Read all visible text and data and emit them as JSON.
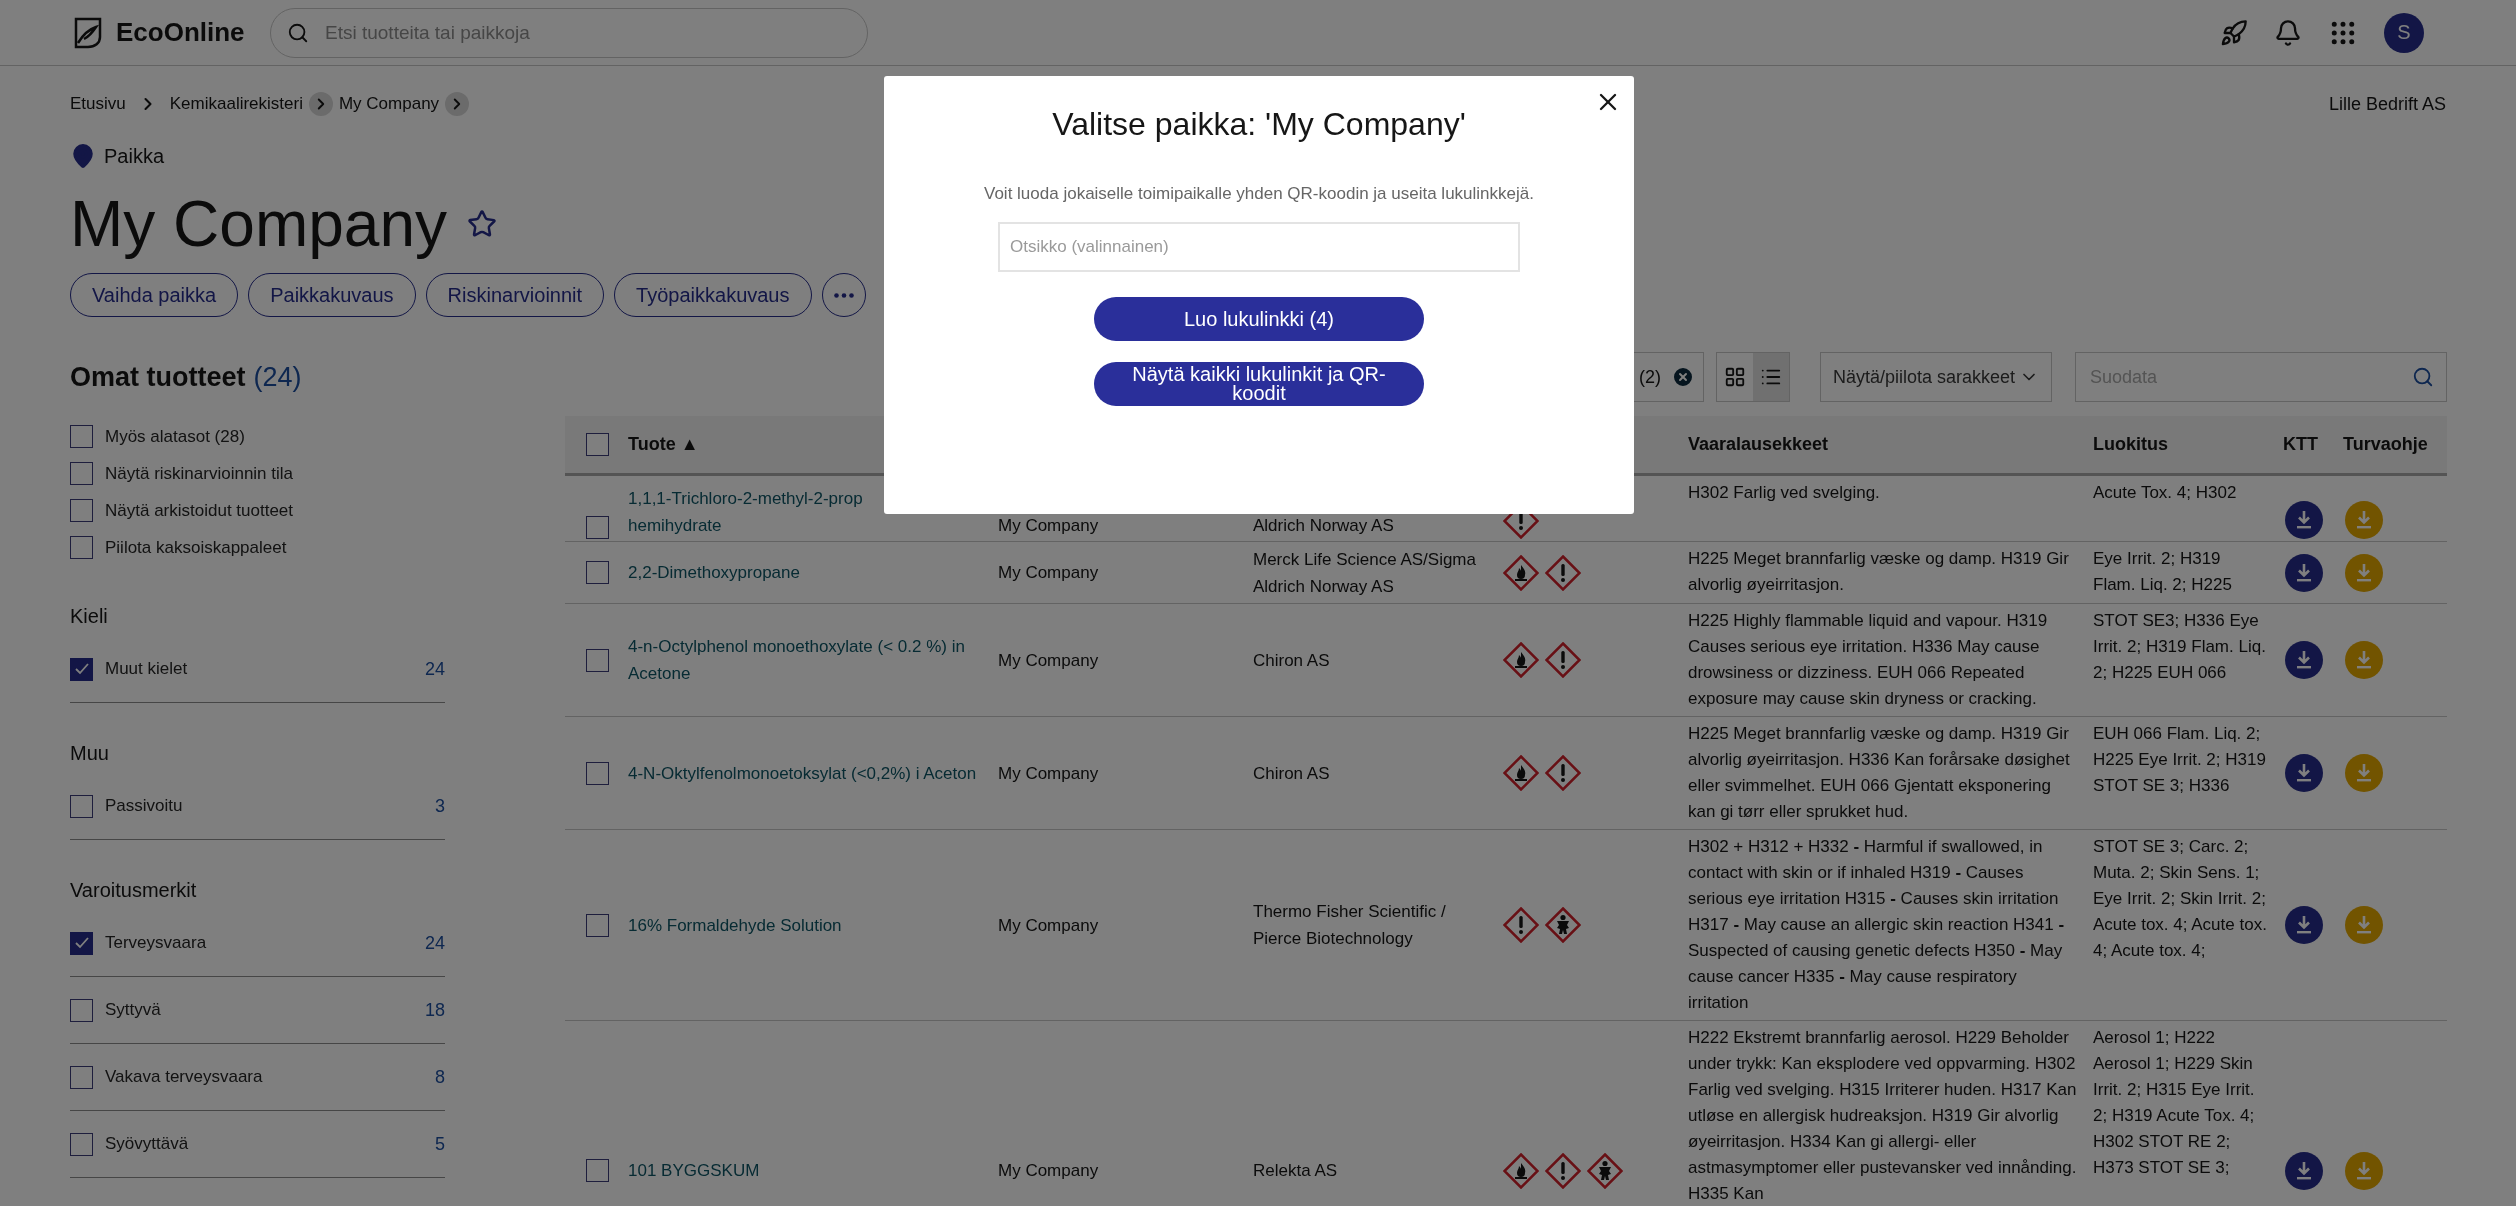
{
  "header": {
    "logo": "EcoOnline",
    "search_placeholder": "Etsi tuotteita tai paikkoja",
    "avatar": "S"
  },
  "breadcrumb": [
    {
      "label": "Etusivu",
      "kind": "plain"
    },
    {
      "label": "Kemikaalirekisteri",
      "kind": "circled"
    },
    {
      "label": "My Company",
      "kind": "circled"
    }
  ],
  "company": "Lille Bedrift AS",
  "location_type": "Paikka",
  "title": "My Company",
  "favorite": false,
  "actions": [
    "Vaihda paikka",
    "Paikkakuvaus",
    "Riskinarvioinnit",
    "Työpaikkakuvaus"
  ],
  "products_heading": {
    "label": "Omat tuotteet",
    "count": "(24)"
  },
  "filter_groups": [
    {
      "items": [
        {
          "label": "Myös alatasot (28)",
          "checked": false
        },
        {
          "label": "Näytä riskinarvioinnin tila",
          "checked": false
        },
        {
          "label": "Näytä arkistoidut tuotteet",
          "checked": false
        },
        {
          "label": "Piilota kaksoiskappaleet",
          "checked": false
        }
      ]
    },
    {
      "title": "Kieli",
      "items": [
        {
          "label": "Muut kielet",
          "checked": true,
          "count": "24"
        }
      ]
    },
    {
      "title": "Muu",
      "items": [
        {
          "label": "Passivoitu",
          "checked": false,
          "count": "3"
        }
      ]
    },
    {
      "title": "Varoitusmerkit",
      "items": [
        {
          "label": "Terveysvaara",
          "checked": true,
          "count": "24"
        },
        {
          "label": "Syttyvä",
          "checked": false,
          "count": "18"
        },
        {
          "label": "Vakava terveysvaara",
          "checked": false,
          "count": "8"
        },
        {
          "label": "Syövyttävä",
          "checked": false,
          "count": "5"
        }
      ]
    }
  ],
  "toolbar": {
    "chip": "(2)",
    "views": [
      {
        "kind": "grid",
        "selected": false
      },
      {
        "kind": "list",
        "selected": true
      }
    ],
    "columns_dropdown": "Näytä/piilota sarakkeet",
    "filter_placeholder": "Suodata"
  },
  "table": {
    "select_all": {
      "checked": false
    },
    "columns": {
      "product": "Tuote ▲",
      "hazard_statements": "Vaaralausekkeet",
      "classification": "Luokitus",
      "sds": "KTT",
      "safety_instructions": "Turvaohje"
    },
    "rows": [
      {
        "checked": false,
        "product": "1,1,1-Trichloro-2-methyl-2-prop\nhemihydrate",
        "location": "My Company",
        "supplier": "Aldrich Norway AS",
        "pictograms": [
          {
            "kind": "exclamation"
          }
        ],
        "hazard_statements": "H302 Farlig ved svelging.",
        "classification": "Acute Tox. 4; H302"
      },
      {
        "checked": false,
        "product": "2,2-Dimethoxypropane",
        "location": "My Company",
        "supplier": "Merck Life Science AS/Sigma Aldrich Norway AS",
        "pictograms": [
          {
            "kind": "flame"
          },
          {
            "kind": "exclamation"
          }
        ],
        "hazard_statements": "H225 Meget brannfarlig væske og damp. H319 Gir alvorlig øyeirritasjon.",
        "classification": "Eye Irrit. 2; H319 Flam. Liq. 2; H225"
      },
      {
        "checked": false,
        "product": "4-n-Octylphenol monoethoxylate (< 0.2 %) in Acetone",
        "location": "My Company",
        "supplier": "Chiron AS",
        "pictograms": [
          {
            "kind": "flame"
          },
          {
            "kind": "exclamation"
          }
        ],
        "hazard_statements": "H225 Highly flammable liquid and vapour. H319 Causes serious eye irritation. H336 May cause drowsiness or dizziness. EUH 066 Repeated exposure may cause skin dryness or cracking.",
        "classification": "STOT SE3; H336 Eye Irrit. 2; H319 Flam. Liq. 2; H225 EUH 066"
      },
      {
        "checked": false,
        "product": "4-N-Oktylfenolmonoetoksylat (<0,2%) i Aceton",
        "location": "My Company",
        "supplier": "Chiron AS",
        "pictograms": [
          {
            "kind": "flame"
          },
          {
            "kind": "exclamation"
          }
        ],
        "hazard_statements": "H225 Meget brannfarlig væske og damp. H319 Gir alvorlig øyeirritasjon. H336 Kan forårsake døsighet eller svimmelhet. EUH 066 Gjentatt eksponering kan gi tørr eller sprukket hud.",
        "classification": "EUH 066 Flam. Liq. 2; H225 Eye Irrit. 2; H319 STOT SE 3; H336"
      },
      {
        "checked": false,
        "product": "16% Formaldehyde Solution",
        "location": "My Company",
        "supplier": "Thermo Fisher Scientific / Pierce Biotechnology",
        "pictograms": [
          {
            "kind": "exclamation"
          },
          {
            "kind": "health"
          }
        ],
        "hazard_statements": "H302 + H312 + H332 **-** Harmful if swallowed, in contact with skin or if inhaled H319 **-** Causes serious eye irritation H315 **-** Causes skin irritation H317 **-** May cause an allergic skin reaction H341 **-** Suspected of causing genetic defects H350 **-** May cause cancer H335 **-** May cause respiratory irritation",
        "classification": "STOT SE 3; Carc. 2; Muta. 2; Skin Sens. 1; Eye Irrit. 2; Skin Irrit. 2; Acute tox. 4; Acute tox. 4; Acute tox. 4;"
      },
      {
        "checked": false,
        "product": "101 BYGGSKUM",
        "location": "My Company",
        "supplier": "Relekta AS",
        "pictograms": [
          {
            "kind": "flame"
          },
          {
            "kind": "exclamation"
          },
          {
            "kind": "health"
          }
        ],
        "hazard_statements": "H222 Ekstremt brannfarlig aerosol. H229 Beholder under trykk: Kan eksplodere ved oppvarming. H302 Farlig ved svelging. H315 Irriterer huden. H317 Kan utløse en allergisk hudreaksjon. H319 Gir alvorlig øyeirritasjon. H334 Kan gi allergi- eller astmasymptomer eller pustevansker ved innånding. H335 Kan",
        "classification": "Aerosol 1; H222 Aerosol 1; H229 Skin Irrit. 2; H315 Eye Irrit. 2; H319 Acute Tox. 4; H302 STOT RE 2; H373 STOT SE 3;"
      }
    ]
  },
  "modal": {
    "title": "Valitse paikka: 'My Company'",
    "text": "Voit luoda jokaiselle toimipaikalle yhden QR-koodin ja useita lukulinkkejä.",
    "input_placeholder": "Otsikko (valinnainen)",
    "buttons": [
      "Luo lukulinkki (4)",
      "Näytä kaikki lukulinkit ja QR-koodit"
    ]
  }
}
